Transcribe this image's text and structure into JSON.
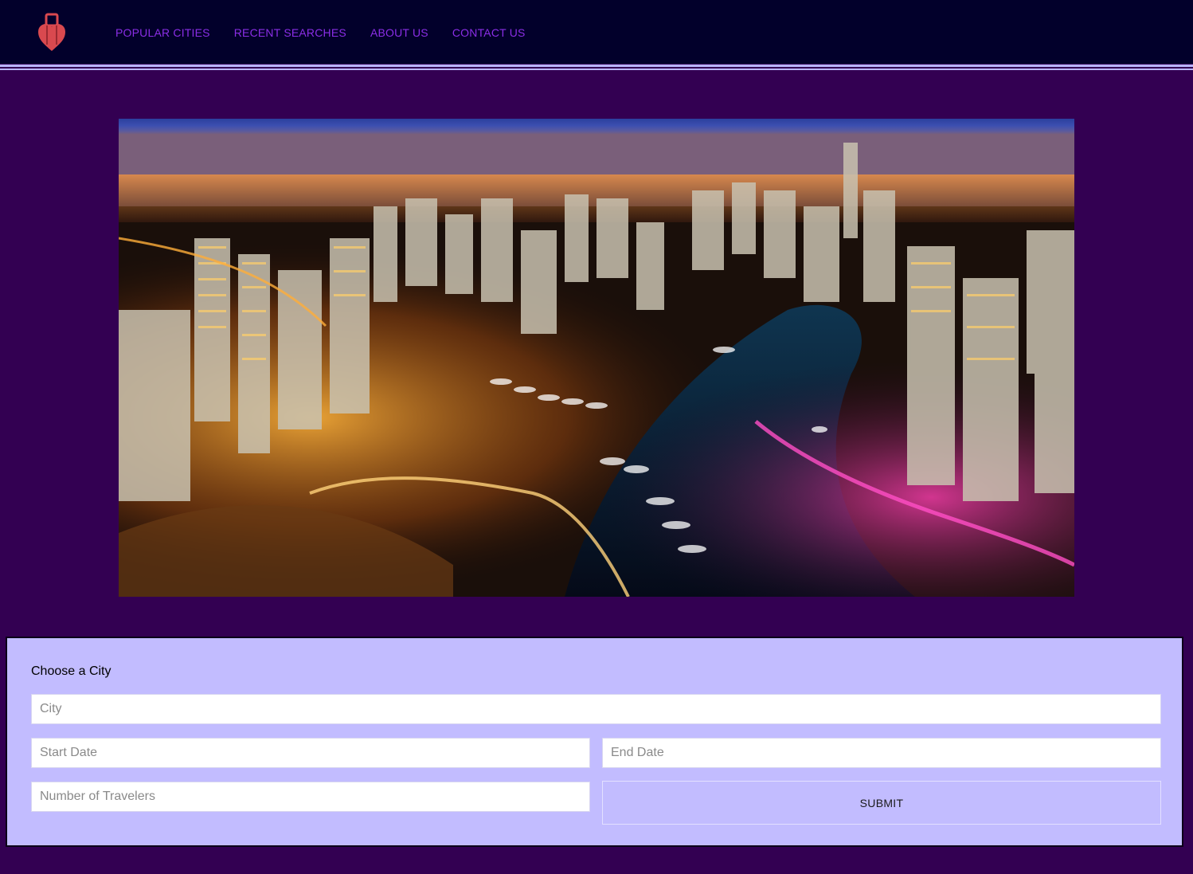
{
  "nav": {
    "logo_icon": "suitcase-heart-logo",
    "links": [
      "POPULAR CITIES",
      "RECENT SEARCHES",
      "ABOUT US",
      "CONTACT US"
    ]
  },
  "hero": {
    "image_desc_icon": "city-night-skyline-image"
  },
  "form": {
    "heading": "Choose a City",
    "city_placeholder": "City",
    "start_placeholder": "Start Date",
    "end_placeholder": "End Date",
    "travelers_placeholder": "Number of Travelers",
    "submit_label": "SUBMIT"
  },
  "colors": {
    "page_bg": "#330052",
    "nav_bg": "#02002b",
    "nav_link": "#8b2ee6",
    "panel_bg": "#c2bcff",
    "logo": "#d9494f"
  }
}
